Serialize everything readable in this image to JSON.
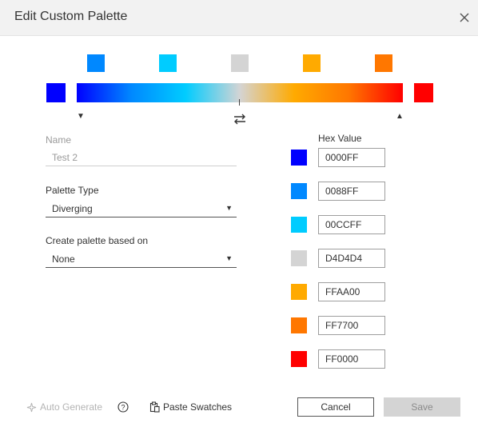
{
  "dialog": {
    "title": "Edit Custom Palette",
    "close_icon": "close-icon"
  },
  "palette_bar": {
    "swatches": [
      {
        "hex": "#0088FF"
      },
      {
        "hex": "#00CCFF"
      },
      {
        "hex": "#D4D4D4"
      },
      {
        "hex": "#FFAA00"
      },
      {
        "hex": "#FF7700"
      }
    ],
    "left_end_color": "#0000FF",
    "right_end_color": "#FF0000",
    "gradient_colors": [
      "#0000FF",
      "#0088FF",
      "#00CCFF",
      "#D4D4D4",
      "#FFAA00",
      "#FF7700",
      "#FF0000"
    ],
    "left_marker_icon": "triangle-down-icon",
    "right_marker_icon": "triangle-up-icon",
    "reverse_icon": "swap-arrows-icon"
  },
  "form": {
    "name_label": "Name",
    "name_value": "Test 2",
    "palette_type_label": "Palette Type",
    "palette_type_value": "Diverging",
    "based_on_label": "Create palette based on",
    "based_on_value": "None"
  },
  "colors": {
    "heading": "Hex Value",
    "rows": [
      {
        "chip": "#0000FF",
        "hex": "0000FF"
      },
      {
        "chip": "#0088FF",
        "hex": "0088FF"
      },
      {
        "chip": "#00CCFF",
        "hex": "00CCFF"
      },
      {
        "chip": "#D4D4D4",
        "hex": "D4D4D4"
      },
      {
        "chip": "#FFAA00",
        "hex": "FFAA00"
      },
      {
        "chip": "#FF7700",
        "hex": "FF7700"
      },
      {
        "chip": "#FF0000",
        "hex": "FF0000"
      }
    ]
  },
  "footer": {
    "auto_generate_label": "Auto Generate",
    "auto_generate_icon": "sparkle-icon",
    "help_icon": "help-circle-icon",
    "paste_label": "Paste Swatches",
    "paste_icon": "clipboard-icon",
    "cancel_label": "Cancel",
    "save_label": "Save"
  }
}
